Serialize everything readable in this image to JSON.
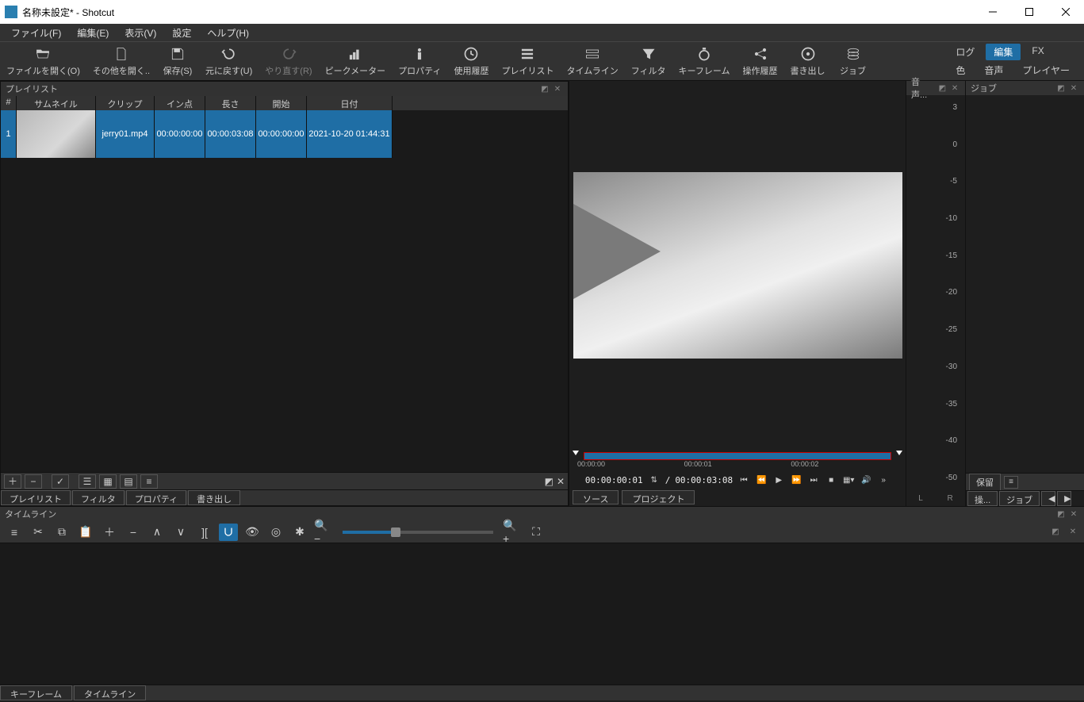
{
  "window": {
    "title": "名称未設定* - Shotcut"
  },
  "menu": {
    "file": "ファイル(F)",
    "edit": "編集(E)",
    "view": "表示(V)",
    "settings": "設定",
    "help": "ヘルプ(H)"
  },
  "toolbar": {
    "open": "ファイルを開く(O)",
    "openOther": "その他を開く..",
    "save": "保存(S)",
    "undo": "元に戻す(U)",
    "redo": "やり直す(R)",
    "peak": "ピークメーター",
    "props": "プロパティ",
    "history": "使用履歴",
    "playlist": "プレイリスト",
    "timeline": "タイムライン",
    "filter": "フィルタ",
    "keyframe": "キーフレーム",
    "opHistory": "操作履歴",
    "export": "書き出し",
    "jobs": "ジョブ"
  },
  "rightTabs": {
    "log": "ログ",
    "edit": "編集",
    "fx": "FX",
    "color": "色",
    "audio": "音声",
    "player": "プレイヤー"
  },
  "playlist": {
    "title": "プレイリスト",
    "headers": {
      "idx": "#",
      "thumb": "サムネイル",
      "clip": "クリップ",
      "in": "イン点",
      "len": "長さ",
      "start": "開始",
      "date": "日付"
    },
    "rows": [
      {
        "idx": "1",
        "clip": "jerry01.mp4",
        "in": "00:00:00:00",
        "len": "00:00:03:08",
        "start": "00:00:00:00",
        "date": "2021-10-20 01:44:31"
      }
    ],
    "bottomTabs": {
      "playlist": "プレイリスト",
      "filter": "フィルタ",
      "props": "プロパティ",
      "export": "書き出し"
    }
  },
  "preview": {
    "ticks": [
      "00:00:00",
      "00:00:01",
      "00:00:02"
    ],
    "timecode": "00:00:00:01",
    "sep": "/",
    "duration": "00:00:03:08",
    "tabs": {
      "source": "ソース",
      "project": "プロジェクト"
    }
  },
  "audioPanel": {
    "title": "音声...",
    "L": "L",
    "R": "R",
    "ticks": [
      "3",
      "0",
      "-5",
      "-10",
      "-15",
      "-20",
      "-25",
      "-30",
      "-35",
      "-40",
      "-50"
    ]
  },
  "jobsPanel": {
    "title": "ジョブ",
    "hold": "保留",
    "op": "操...",
    "jobs": "ジョブ"
  },
  "timeline": {
    "title": "タイムライン",
    "tabs": {
      "keyframe": "キーフレーム",
      "timeline": "タイムライン"
    }
  }
}
